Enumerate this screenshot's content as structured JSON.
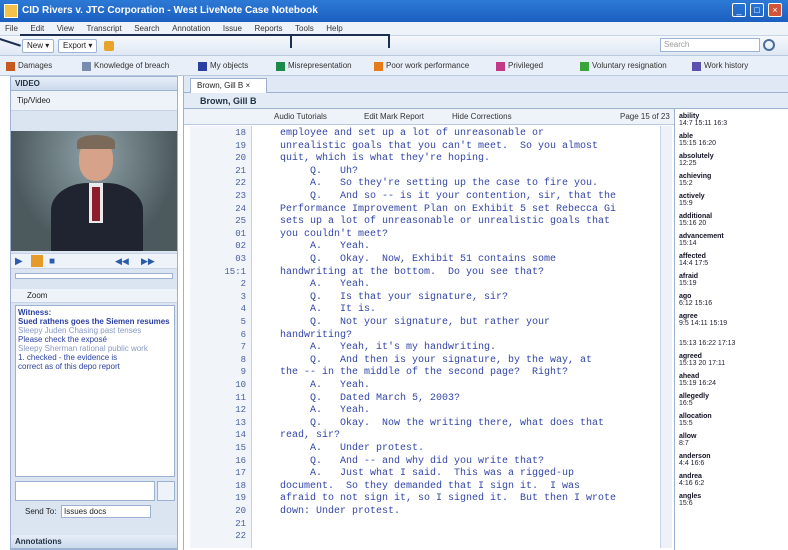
{
  "window": {
    "title": "CID Rivers v. JTC Corporation - West LiveNote Case Notebook",
    "min": "_",
    "max": "□",
    "close": "×"
  },
  "menu": [
    "File",
    "Edit",
    "View",
    "Transcript",
    "Search",
    "Annotation",
    "Issue",
    "Reports",
    "Tools",
    "Help"
  ],
  "toolbar": {
    "new_label": "New ▾",
    "export_label": "Export ▾",
    "search_placeholder": "Search"
  },
  "issues": [
    {
      "label": "Damages",
      "color": "#c65a1e"
    },
    {
      "label": "Knowledge of breach",
      "color": "#7a8bb0"
    },
    {
      "label": "My objects",
      "color": "#2a3fa0"
    },
    {
      "label": "Misrepresentation",
      "color": "#1b8a4b"
    },
    {
      "label": "Poor work performance",
      "color": "#e67b1a"
    },
    {
      "label": "Privileged",
      "color": "#c23a87"
    },
    {
      "label": "Voluntary resignation",
      "color": "#3aa53a"
    },
    {
      "label": "Work history",
      "color": "#5b4fb0"
    }
  ],
  "leftpane": {
    "header": "VIDEO",
    "subheader": "Tip/Video",
    "zoom": "Zoom",
    "send_to_label": "Send To:",
    "send_to_value": "Issues docs",
    "notes_header": "Annotations",
    "notes": [
      "Witness:",
      "Sued rathens goes the Siemen resumes",
      "Sleepy Juden Chasing past tenses",
      "Please check the exposé",
      "Sleepy Sherman rational public work",
      "1. checked - the evidence is",
      "correct as of this depo report"
    ]
  },
  "doc": {
    "tab": "Brown, Gill B ×",
    "deponent": "Brown, Gill B",
    "toolbar": [
      "Audio Tutorials",
      "Edit Mark Report",
      "Hide Corrections",
      "Page 15 of 23"
    ]
  },
  "lines": [
    {
      "n": "18",
      "t": "   employee and set up a lot of unreasonable or"
    },
    {
      "n": "19",
      "t": "   unrealistic goals that you can't meet.  So you almost"
    },
    {
      "n": "20",
      "t": "   quit, which is what they're hoping."
    },
    {
      "n": "21",
      "t": "        Q.   Uh?"
    },
    {
      "n": "22",
      "t": "        A.   So they're setting up the case to fire you."
    },
    {
      "n": "23",
      "t": "        Q.   And so -- is it your contention, sir, that the"
    },
    {
      "n": "24",
      "t": "   Performance Improvement Plan on Exhibit 5 set Rebecca Gi"
    },
    {
      "n": "25",
      "t": "   sets up a lot of unreasonable or unrealistic goals that"
    },
    {
      "n": "01",
      "t": "   you couldn't meet?"
    },
    {
      "n": "02",
      "t": "        A.   Yeah."
    },
    {
      "n": "03",
      "t": "        Q.   Okay.  Now, Exhibit 51 contains some"
    },
    {
      "n": "15:1",
      "t": "   handwriting at the bottom.  Do you see that?"
    },
    {
      "n": "2",
      "t": "        A.   Yeah."
    },
    {
      "n": "3",
      "t": "        Q.   Is that your signature, sir?"
    },
    {
      "n": "4",
      "t": "        A.   It is."
    },
    {
      "n": "5",
      "t": "        Q.   Not your signature, but rather your"
    },
    {
      "n": "6",
      "t": "   handwriting?"
    },
    {
      "n": "7",
      "t": "        A.   Yeah, it's my handwriting."
    },
    {
      "n": "8",
      "t": "        Q.   And then is your signature, by the way, at"
    },
    {
      "n": "9",
      "t": "   the -- in the middle of the second page?  Right?"
    },
    {
      "n": "10",
      "t": "        A.   Yeah."
    },
    {
      "n": "11",
      "t": "        Q.   Dated March 5, 2003?"
    },
    {
      "n": "12",
      "t": "        A.   Yeah."
    },
    {
      "n": "13",
      "t": "        Q.   Okay.  Now the writing there, what does that"
    },
    {
      "n": "14",
      "t": "   read, sir?"
    },
    {
      "n": "15",
      "t": "        A.   Under protest."
    },
    {
      "n": "16",
      "t": "        Q.   And -- and why did you write that?"
    },
    {
      "n": "17",
      "t": "        A.   Just what I said.  This was a rigged-up"
    },
    {
      "n": "18",
      "t": "   document.  So they demanded that I sign it.  I was"
    },
    {
      "n": "19",
      "t": "   afraid to not sign it, so I signed it.  But then I wrote"
    },
    {
      "n": "20",
      "t": "   down: Under protest."
    },
    {
      "n": "21",
      "t": ""
    },
    {
      "n": "22",
      "t": ""
    }
  ],
  "words": [
    {
      "w": "ability",
      "r": "14:7 15:11 16:3"
    },
    {
      "w": "able",
      "r": "15:15 16:20"
    },
    {
      "w": "absolutely",
      "r": "12:25"
    },
    {
      "w": "achieving",
      "r": "15:2"
    },
    {
      "w": "actively",
      "r": "15:9"
    },
    {
      "w": "additional",
      "r": "15:16 20"
    },
    {
      "w": "advancement",
      "r": "15:14"
    },
    {
      "w": "affected",
      "r": "14:4 17:5"
    },
    {
      "w": "afraid",
      "r": "15:19"
    },
    {
      "w": "ago",
      "r": "6:12 15:16"
    },
    {
      "w": "agree",
      "r": "9:5 14:11 15:19"
    },
    {
      "w": "",
      "r": "15:13 16:22 17:13"
    },
    {
      "w": "agreed",
      "r": "15:13 20 17:11"
    },
    {
      "w": "ahead",
      "r": "15:19 16:24"
    },
    {
      "w": "allegedly",
      "r": "16:5"
    },
    {
      "w": "allocation",
      "r": "15:5"
    },
    {
      "w": "allow",
      "r": "8:7"
    },
    {
      "w": "anderson",
      "r": "4:4 16:6"
    },
    {
      "w": "andrea",
      "r": "4:16 6:2"
    },
    {
      "w": "angles",
      "r": "15:6"
    }
  ]
}
